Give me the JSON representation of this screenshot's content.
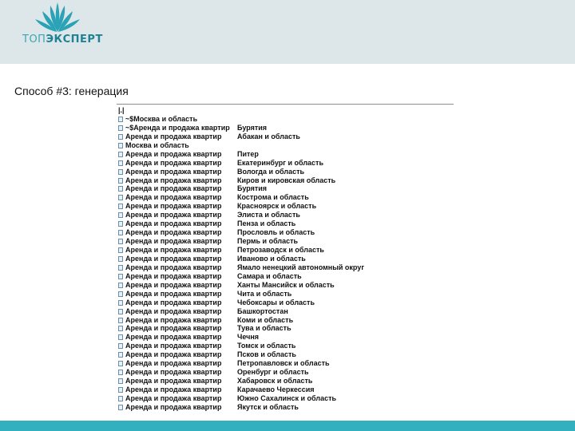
{
  "logo": {
    "text_part1": "ТОП",
    "text_part2": "ЭКСПЕРТ"
  },
  "slide": {
    "title": "Способ #3: генерация"
  },
  "list": {
    "header": "|.|",
    "rows": [
      {
        "col1": "~$Москва и область",
        "col2": ""
      },
      {
        "col1": "~$Аренда и продажа квартир",
        "col2": "Бурятия"
      },
      {
        "col1": "Аренда и продажа квартир",
        "col2": "Абакан и область"
      },
      {
        "col1": "Москва и область",
        "col2": ""
      },
      {
        "col1": "Аренда и продажа квартир",
        "col2": "Питер"
      },
      {
        "col1": "Аренда и продажа квартир",
        "col2": "Екатеринбург и область"
      },
      {
        "col1": "Аренда и продажа квартир",
        "col2": "Вологда и область"
      },
      {
        "col1": "Аренда и продажа квартир",
        "col2": "Киров и кировская область"
      },
      {
        "col1": "Аренда и продажа квартир",
        "col2": "Бурятия"
      },
      {
        "col1": "Аренда и продажа квартир",
        "col2": "Кострома и область"
      },
      {
        "col1": "Аренда и продажа квартир",
        "col2": "Красноярск и область"
      },
      {
        "col1": "Аренда и продажа квартир",
        "col2": "Элиста и область"
      },
      {
        "col1": "Аренда и продажа квартир",
        "col2": "Пенза и область"
      },
      {
        "col1": "Аренда и продажа квартир",
        "col2": "Прословль и область"
      },
      {
        "col1": "Аренда и продажа квартир",
        "col2": "Пермь и область"
      },
      {
        "col1": "Аренда и продажа квартир",
        "col2": "Петрозаводск и область"
      },
      {
        "col1": "Аренда и продажа квартир",
        "col2": "Иваново и область"
      },
      {
        "col1": "Аренда и продажа квартир",
        "col2": "Ямало ненецкий автономный округ"
      },
      {
        "col1": "Аренда и продажа квартир",
        "col2": "Самара и область"
      },
      {
        "col1": "Аренда и продажа квартир",
        "col2": "Ханты Мансийск и область"
      },
      {
        "col1": "Аренда и продажа квартир",
        "col2": "Чита и область"
      },
      {
        "col1": "Аренда и продажа квартир",
        "col2": "Чебоксары и область"
      },
      {
        "col1": "Аренда и продажа квартир",
        "col2": "Башкортостан"
      },
      {
        "col1": "Аренда и продажа квартир",
        "col2": "Коми и область"
      },
      {
        "col1": "Аренда и продажа квартир",
        "col2": "Тува и область"
      },
      {
        "col1": "Аренда и продажа квартир",
        "col2": "Чечня"
      },
      {
        "col1": "Аренда и продажа квартир",
        "col2": "Томск и область"
      },
      {
        "col1": "Аренда и продажа квартир",
        "col2": "Псков и область"
      },
      {
        "col1": "Аренда и продажа квартир",
        "col2": "Петропавловск и область"
      },
      {
        "col1": "Аренда и продажа квартир",
        "col2": "Оренбург и область"
      },
      {
        "col1": "Аренда и продажа квартир",
        "col2": "Хабаровск и область"
      },
      {
        "col1": "Аренда и продажа квартир",
        "col2": "Карачаево Черкессия"
      },
      {
        "col1": "Аренда и продажа квартир",
        "col2": "Южно Сахалинск и область"
      },
      {
        "col1": "Аренда и продажа квартир",
        "col2": "Якутск и область"
      }
    ]
  }
}
